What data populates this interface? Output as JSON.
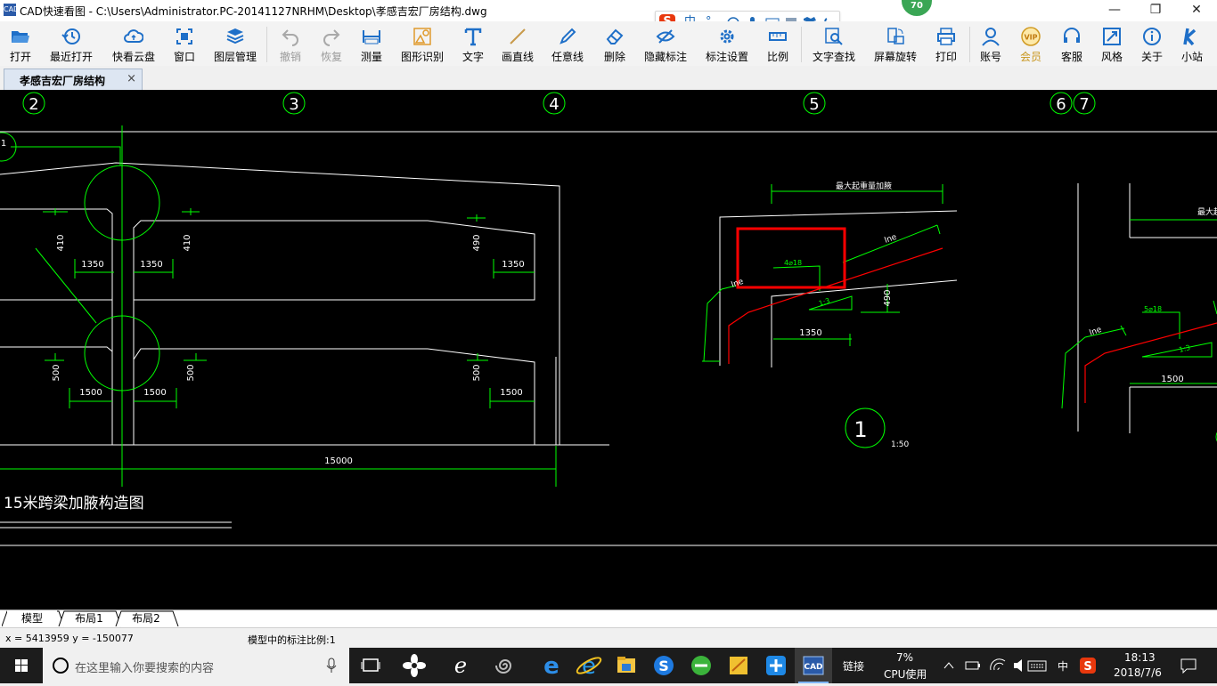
{
  "window": {
    "title": "CAD快速看图 - C:\\Users\\Administrator.PC-20141127NRHM\\Desktop\\孝感吉宏厂房结构.dwg",
    "app_icon_text": "CAD",
    "minimize": "—",
    "restore": "❐",
    "close": "✕"
  },
  "ime": {
    "logo": "S",
    "lang": "中",
    "punct": "°,"
  },
  "notify_badge": "70",
  "toolbar": {
    "open": "打开",
    "recent": "最近打开",
    "cloud": "快看云盘",
    "window": "窗口",
    "layers": "图层管理",
    "undo": "撤销",
    "redo": "恢复",
    "measure": "测量",
    "recognize": "图形识别",
    "text": "文字",
    "line": "画直线",
    "freeline": "任意线",
    "erase": "删除",
    "hide_dim": "隐藏标注",
    "dim_settings": "标注设置",
    "scale": "比例",
    "text_search": "文字查找",
    "rotate": "屏幕旋转",
    "print": "打印",
    "account": "账号",
    "member": "会员",
    "service": "客服",
    "style": "风格",
    "about": "关于",
    "site": "小站",
    "vip_badge": "VIP"
  },
  "doc_tab": {
    "title": "孝感吉宏厂房结构",
    "close": "×"
  },
  "drawing": {
    "grid_labels": [
      "2",
      "3",
      "4",
      "5",
      "6",
      "7"
    ],
    "left_partial_label": "1",
    "dims": [
      "410",
      "410",
      "490",
      "1350",
      "1350",
      "1350",
      "500",
      "500",
      "500",
      "1500",
      "1500",
      "1500",
      "15000",
      "1350",
      "490",
      "1500"
    ],
    "section_labels": [
      "lne",
      "lne",
      "lne",
      "4⌀18",
      "5⌀18",
      "1:3",
      "1:3",
      "1:50"
    ],
    "top_note": "最大起重量加腋",
    "top_note_right": "最大起",
    "detail_number": "1",
    "caption": "15米跨梁加腋构造图"
  },
  "layout_tabs": [
    "模型",
    "布局1",
    "布局2"
  ],
  "status": {
    "coords": "x = 5413959  y = -150077",
    "scale_note": "模型中的标注比例:1"
  },
  "taskbar": {
    "search_placeholder": "在这里输入你要搜索的内容",
    "link": "链接",
    "cpu_pct": "7%",
    "cpu_label": "CPU使用",
    "ime_lang": "中",
    "time": "18:13",
    "date": "2018/7/6"
  },
  "colors": {
    "canvas_bg": "#000000",
    "cad_white": "#ffffff",
    "cad_green": "#00ff00",
    "cad_red": "#ff0000",
    "toolbar_icon": "#1e6fc8"
  }
}
